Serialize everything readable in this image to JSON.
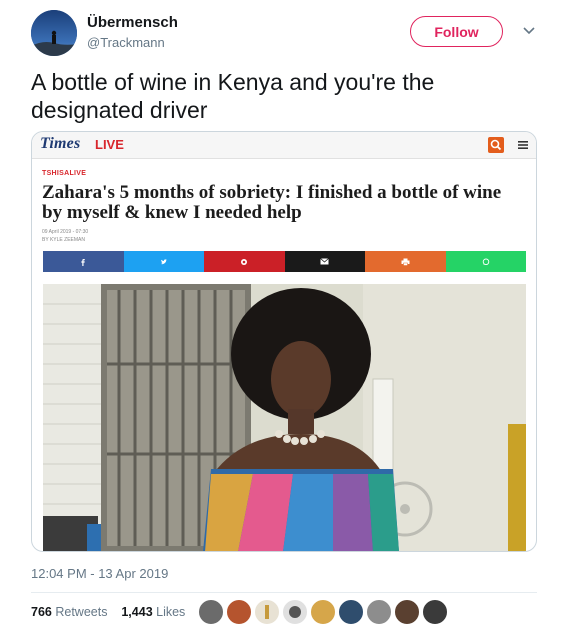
{
  "tweet": {
    "display_name": "Übermensch",
    "handle": "@Trackmann",
    "follow_label": "Follow",
    "text": "A bottle of wine in Kenya and you're the designated driver",
    "timestamp": "12:04 PM - 13 Apr 2019",
    "retweets_count": "766",
    "retweets_label": "Retweets",
    "likes_count": "1,443",
    "likes_label": "Likes"
  },
  "card": {
    "logo_times": "Times",
    "logo_live": "LIVE",
    "section": "TSHISALIVE",
    "headline": "Zahara's 5 months of sobriety: I finished a bottle of wine by myself & knew I needed help",
    "date": "09 April 2019 - 07:30",
    "byline": "BY KYLE ZEEMAN",
    "share_buttons": [
      {
        "name": "facebook",
        "color": "#3b5998"
      },
      {
        "name": "twitter",
        "color": "#1da1f2"
      },
      {
        "name": "pinterest",
        "color": "#cb2027"
      },
      {
        "name": "email",
        "color": "#1a1a1a"
      },
      {
        "name": "print",
        "color": "#e36a2e"
      },
      {
        "name": "whatsapp",
        "color": "#25d366"
      }
    ]
  },
  "colors": {
    "accent": "#e0245e",
    "secondary_text": "#657786",
    "brand_red": "#d8262c"
  },
  "icons": [
    "chevron-down-icon",
    "search-icon",
    "menu-icon"
  ]
}
